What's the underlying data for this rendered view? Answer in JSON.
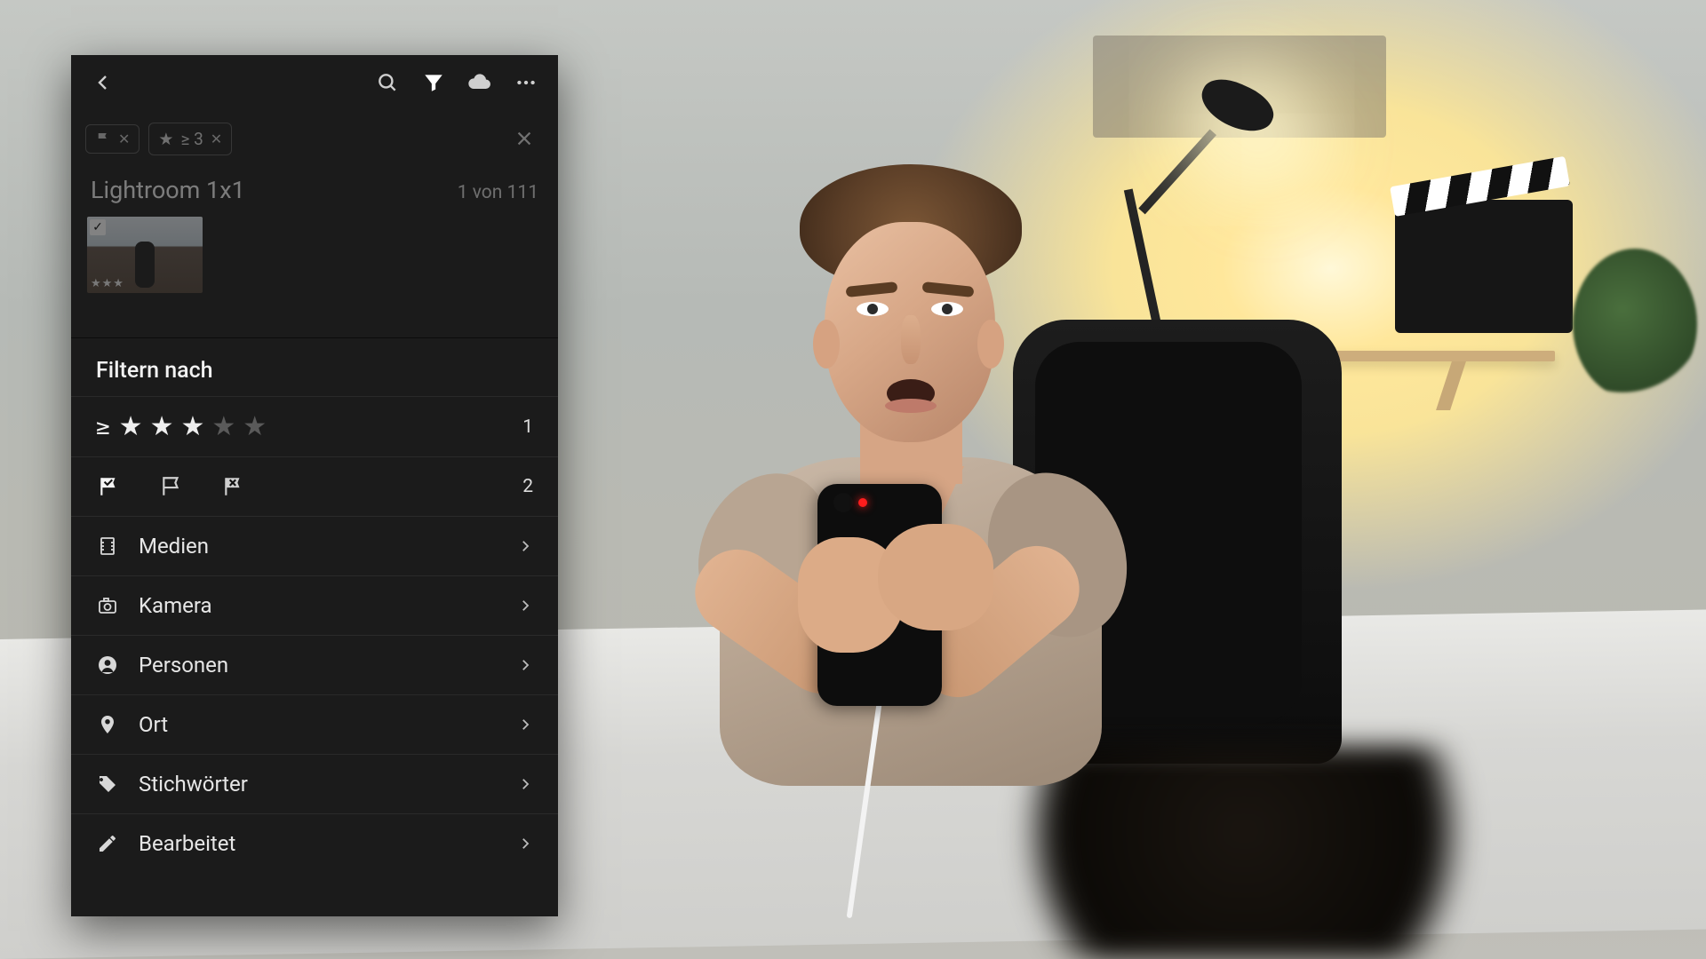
{
  "toolbar": {
    "back": "back",
    "search": "search",
    "filter": "filter",
    "cloud": "cloud",
    "more": "more"
  },
  "chips": {
    "flag_label": "flag-chip",
    "star_label": "≥ 3",
    "close": "close-filter-chips"
  },
  "album": {
    "title": "Lightroom 1x1",
    "count_text": "1 von 111",
    "thumb_stars": "★★★"
  },
  "filter": {
    "title": "Filtern nach",
    "star_count": "1",
    "flag_count": "2",
    "options": {
      "media": "Medien",
      "camera": "Kamera",
      "people": "Personen",
      "location": "Ort",
      "keywords": "Stichwörter",
      "edited": "Bearbeitet"
    }
  }
}
